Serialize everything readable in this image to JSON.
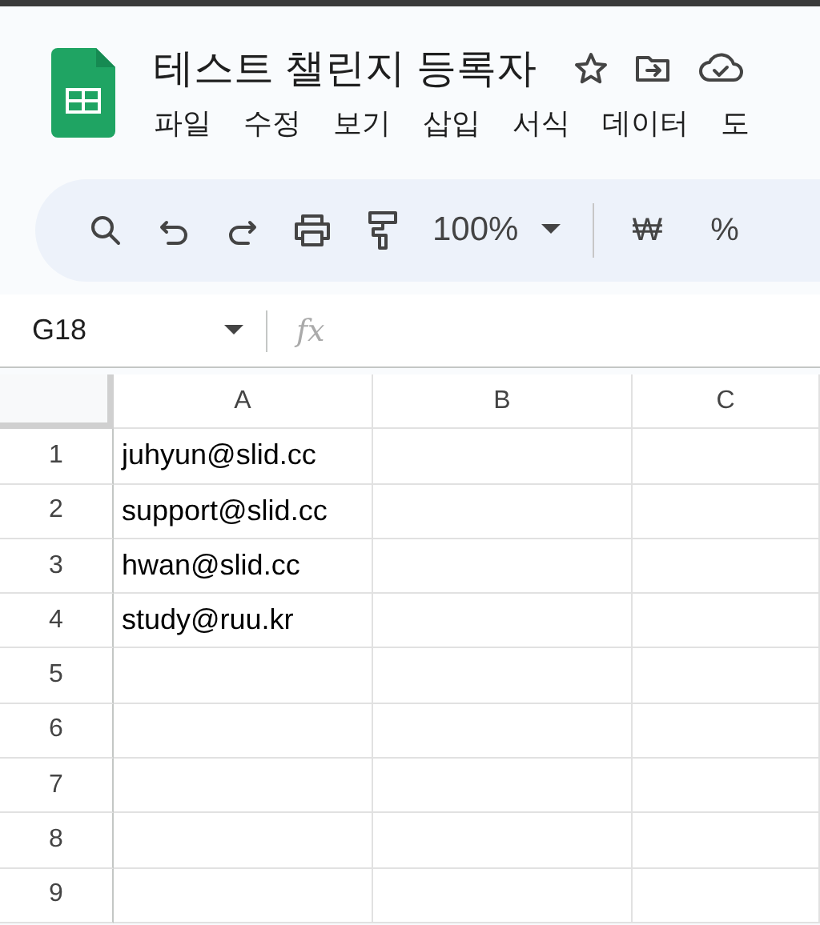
{
  "header": {
    "title": "테스트 챌린지 등록자",
    "menu": [
      "파일",
      "수정",
      "보기",
      "삽입",
      "서식",
      "데이터",
      "도"
    ]
  },
  "toolbar": {
    "zoom": "100%",
    "currency": "₩",
    "percent": "%"
  },
  "formula_bar": {
    "name_box": "G18",
    "fx": "fx"
  },
  "grid": {
    "columns": [
      "A",
      "B",
      "C"
    ],
    "rows": [
      {
        "number": "1",
        "cell_a": "juhyun@slid.cc"
      },
      {
        "number": "2",
        "cell_a": "support@slid.cc"
      },
      {
        "number": "3",
        "cell_a": "hwan@slid.cc"
      },
      {
        "number": "4",
        "cell_a": "study@ruu.kr"
      },
      {
        "number": "5"
      },
      {
        "number": "6"
      },
      {
        "number": "7"
      },
      {
        "number": "8"
      },
      {
        "number": "9"
      }
    ]
  }
}
